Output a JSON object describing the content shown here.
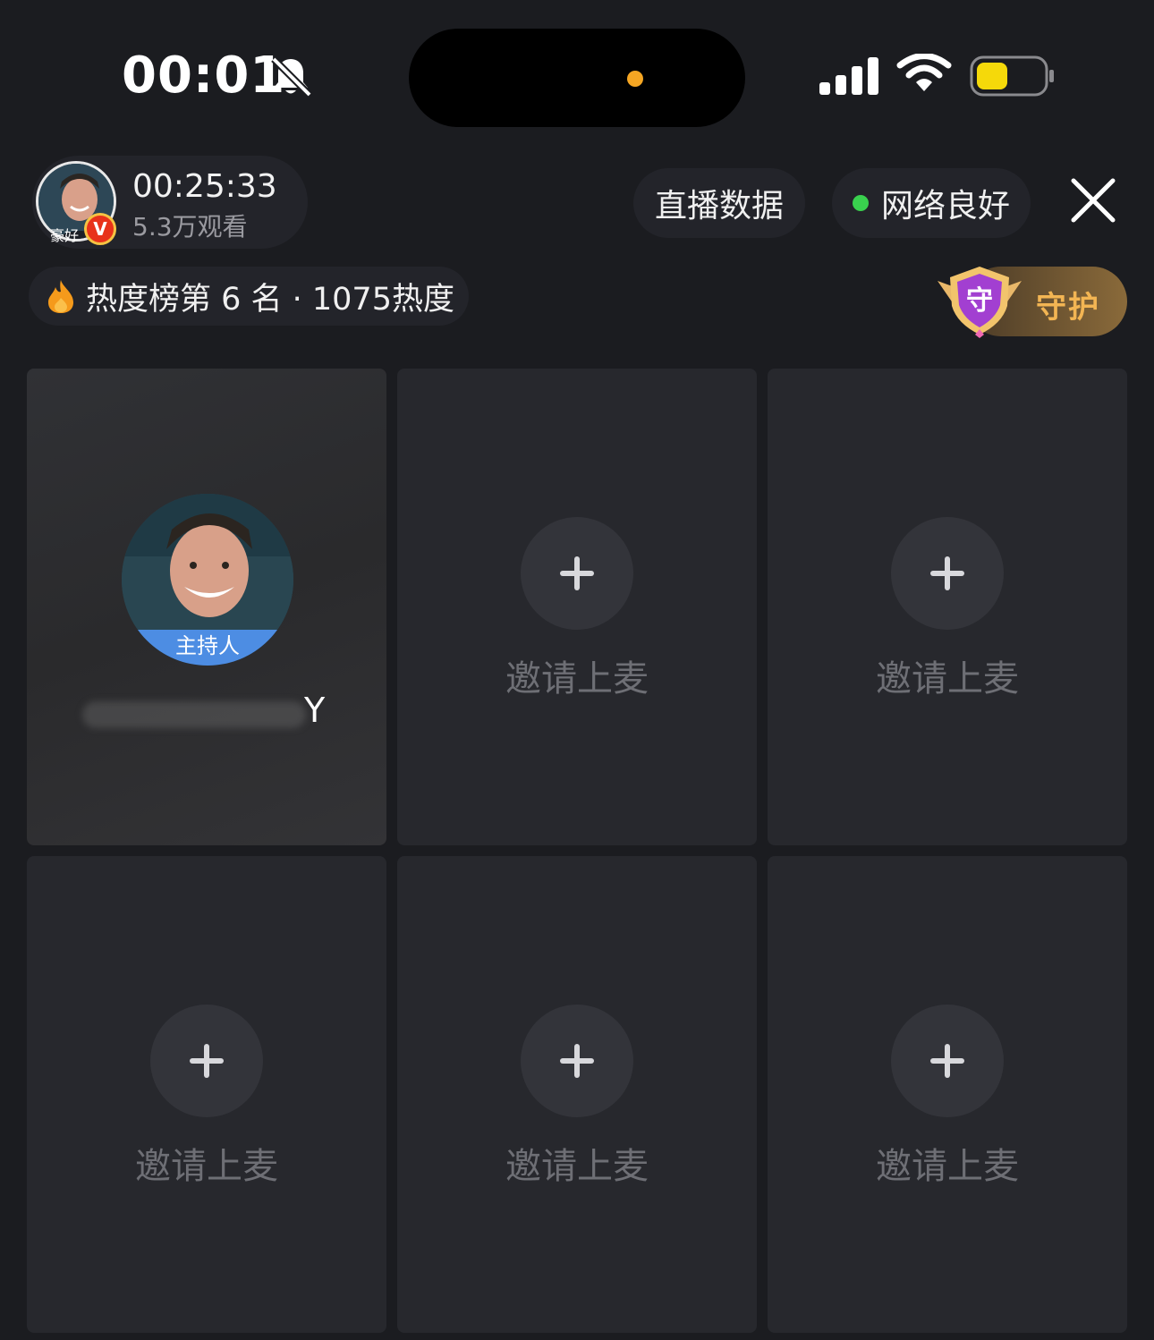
{
  "status_bar": {
    "time": "00:01",
    "accent_dot_color": "#f5a623",
    "battery_color": "#f5d90a"
  },
  "host": {
    "avatar_tag": "豪好",
    "verified_mark": "V",
    "duration": "00:25:33",
    "viewers": "5.3万观看"
  },
  "header": {
    "live_data_label": "直播数据",
    "network_label": "网络良好",
    "network_color": "#39d14e"
  },
  "heat": {
    "text": "热度榜第 6 名 · 1075热度"
  },
  "guard": {
    "label": "守护",
    "shield_char": "守"
  },
  "seats": [
    {
      "type": "host",
      "badge": "主持人",
      "name_tail": "Y"
    },
    {
      "type": "empty",
      "label": "邀请上麦"
    },
    {
      "type": "empty",
      "label": "邀请上麦"
    },
    {
      "type": "empty",
      "label": "邀请上麦"
    },
    {
      "type": "empty",
      "label": "邀请上麦"
    },
    {
      "type": "empty",
      "label": "邀请上麦"
    }
  ],
  "icons": [
    "bell-muted-icon",
    "signal-icon",
    "wifi-icon",
    "battery-icon",
    "close-icon",
    "flame-icon",
    "plus-icon",
    "shield-icon"
  ]
}
